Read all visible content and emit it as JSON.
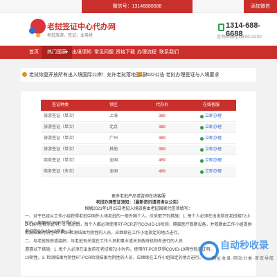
{
  "topbar": {
    "wechat": "微信号：13146888688",
    "add_wechat": "添加微信"
  },
  "header": {
    "title": "老挝签证中心代办网",
    "subtitle": "老挝旅游、签证、业务经",
    "phone": "1314-688-6688",
    "phone_sub": "咨询热线时间8:00-23:00"
  },
  "nav": {
    "items": [
      "首页",
      "热门国家",
      "出境须知",
      "常见问题",
      "资格下载",
      "办理流程",
      "联系我们"
    ]
  },
  "notices": [
    "老挝恢复开放所有出入境国际口岸！允许老挝落地签证！",
    "2022公告 老挝办理签证与入境要求"
  ],
  "table": {
    "headers": [
      "签证种类",
      "领区",
      "代办价",
      "在线客服"
    ],
    "rows": [
      {
        "type": "旅游签证（单次）",
        "region": "上海",
        "price": "389",
        "action": "立即办理"
      },
      {
        "type": "旅游签证（单次）",
        "region": "北京",
        "price": "389",
        "action": "立即办理"
      },
      {
        "type": "旅游签证（单次）",
        "region": "广州",
        "price": "389",
        "action": "立即办理"
      },
      {
        "type": "旅游签证（单次）",
        "region": "其他",
        "price": "389",
        "action": "立即办理"
      },
      {
        "type": "商务签证（单次）",
        "region": "全国",
        "price": "489",
        "action": "立即办理"
      },
      {
        "type": "商务签证（多次）",
        "region": "全国",
        "price": "489",
        "action": "立即办理"
      }
    ]
  },
  "notes": {
    "line1": "更多老挝产品请咨询在线客服",
    "line2": "老挝办理签证须知：（最新资讯请咨询以公告）",
    "line3": "根据2021年1月25日老挝入境旅客由老挝国家代签须填写：",
    "paragraphs": [
      "一、对于已经从工作小组获得老挝中国外入境老挝的一般外国个人、应采取下列措施：1. 每个人必须在出发前在老挝相72小时内，使用RT-PCR获得COVI",
      "D-19阴性检测证明；2. 抵达后，每个人都必须使用RT-PCR进行COVID-19检测，隔离医疗观察设备，并观察由工作小组提供老挝的COVID-19病毒。3.",
      "检测结果为阴性RT-PCR检测结果为阴性的人员，应继续在工作小组指定的地点进行。",
      "二、与老挝政府或组织、与老挝有关或在工作人员和事业或关系政府机构有进行的人员",
      "遵遵以下措施：1. 每个人必须在出发前在老挝相72小时内，使用RT-PCR获得COVID-19阴性检测证明，",
      "19阴性。3. 检测结果为阴性RT-PCR检测结果为阴性的人员，应继续在工作小组指定的地点进行。"
    ]
  },
  "watermark": {
    "brand": "自动秒收录",
    "sub": "网址收录·网站分类·首页导航"
  },
  "colors": {
    "brand_red": "#c9302c",
    "price_red": "#c9302c",
    "link_blue": "#2b6cd6"
  }
}
